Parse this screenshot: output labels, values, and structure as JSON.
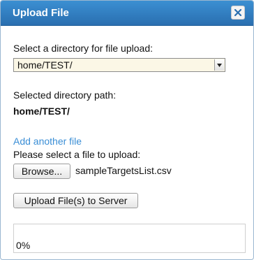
{
  "dialog": {
    "title": "Upload File",
    "close_icon": "close-icon"
  },
  "directory": {
    "prompt": "Select a directory for file upload:",
    "selected": "home/TEST/",
    "path_label": "Selected directory path:",
    "path_value": "home/TEST/"
  },
  "files": {
    "add_link": "Add another file",
    "prompt": "Please select a file to upload:",
    "browse_label": "Browse...",
    "filename": "sampleTargetsList.csv"
  },
  "upload": {
    "button_label": "Upload File(s) to Server"
  },
  "progress": {
    "value": 0,
    "text": "0%"
  },
  "colors": {
    "titlebar": "#2f7fc4",
    "link": "#3a8ed6",
    "select_bg": "#fbf7e6"
  }
}
